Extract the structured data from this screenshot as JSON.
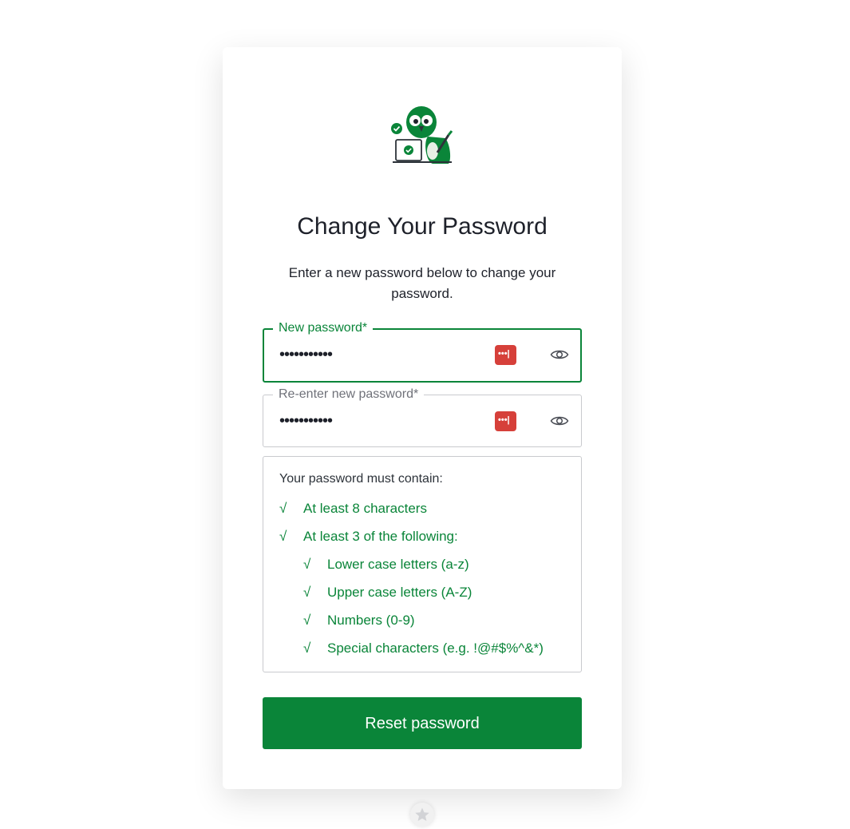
{
  "page": {
    "title": "Change Your Password",
    "subtitle": "Enter a new password below to change your password."
  },
  "new_password": {
    "label": "New password*",
    "value": "•••••••••••",
    "manager_icon": "password-manager-icon",
    "toggle_icon": "eye-icon"
  },
  "confirm_password": {
    "label": "Re-enter new password*",
    "value": "•••••••••••",
    "manager_icon": "password-manager-icon",
    "toggle_icon": "eye-icon"
  },
  "requirements": {
    "heading": "Your password must contain:",
    "check_glyph": "√",
    "items": [
      {
        "text": "At least 8 characters"
      },
      {
        "text": "At least 3 of the following:"
      },
      {
        "text": "Lower case letters (a-z)"
      },
      {
        "text": "Upper case letters (A-Z)"
      },
      {
        "text": "Numbers (0-9)"
      },
      {
        "text": "Special characters (e.g. !@#$%^&*)"
      }
    ]
  },
  "submit": {
    "label": "Reset password"
  },
  "colors": {
    "accent": "#0a8539",
    "password_manager": "#d6403a",
    "text": "#1e212a",
    "border": "#c9cace"
  }
}
